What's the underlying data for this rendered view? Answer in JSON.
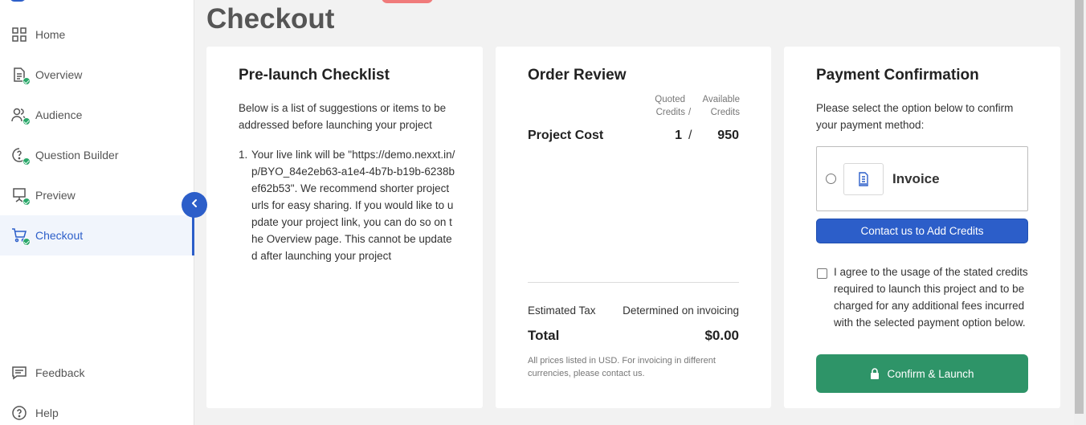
{
  "sidebar": {
    "items": [
      {
        "label": "Home",
        "icon": "grid-icon"
      },
      {
        "label": "Overview",
        "icon": "document-icon",
        "completed": true
      },
      {
        "label": "Audience",
        "icon": "users-icon",
        "completed": true
      },
      {
        "label": "Question Builder",
        "icon": "question-icon",
        "completed": true
      },
      {
        "label": "Preview",
        "icon": "presentation-icon",
        "completed": true
      },
      {
        "label": "Checkout",
        "icon": "cart-icon",
        "completed": true,
        "active": true
      }
    ],
    "footer_items": [
      {
        "label": "Feedback",
        "icon": "message-icon"
      },
      {
        "label": "Help",
        "icon": "help-icon"
      }
    ]
  },
  "page": {
    "title": "Checkout"
  },
  "checklist": {
    "title": "Pre-launch Checklist",
    "intro": "Below is a list of suggestions or items to be addressed before launching your project",
    "items": [
      {
        "number": "1.",
        "text": "Your live link will be \"https://demo.nexxt.in/p/BYO_84e2eb63-a1e4-4b7b-b19b-6238bef62b53\". We recommend shorter project urls for easy sharing. If you would like to update your project link, you can do so on the Overview page. This cannot be updated after launching your project"
      }
    ]
  },
  "order": {
    "title": "Order Review",
    "col_quoted_1": "Quoted",
    "col_quoted_2": "Credits",
    "col_sep": "/",
    "col_available_1": "Available",
    "col_available_2": "Credits",
    "project_cost_label": "Project Cost",
    "quoted_credits": "1",
    "separator": "/",
    "available_credits": "950",
    "tax_label": "Estimated Tax",
    "tax_value": "Determined on invoicing",
    "total_label": "Total",
    "total_value": "$0.00",
    "footnote": "All prices listed in USD. For invoicing in different currencies, please contact us."
  },
  "payment": {
    "title": "Payment Confirmation",
    "intro": "Please select the option below to confirm your payment method:",
    "option_label": "Invoice",
    "option_icon": "invoice-icon",
    "contact_button": "Contact us to Add Credits",
    "agree_text": "I agree to the usage of the stated credits required to launch this project and to be charged for any additional fees incurred with the selected payment option below.",
    "confirm_button": "Confirm & Launch"
  },
  "colors": {
    "accent": "#2c5ec9",
    "success": "#2e9468",
    "check": "#2aa869"
  }
}
